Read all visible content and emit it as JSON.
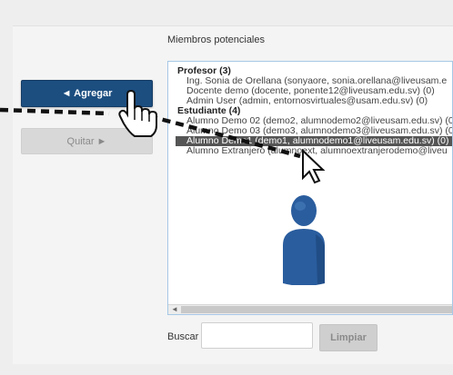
{
  "members": {
    "title": "Miembros potenciales",
    "groups": [
      {
        "label": "Profesor (3)",
        "options": [
          "Ing. Sonia de Orellana (sonyaore, sonia.orellana@liveusam.e",
          "Docente demo (docente, ponente12@liveusam.edu.sv) (0)",
          "Admin User (admin, entornosvirtuales@usam.edu.sv) (0)"
        ]
      },
      {
        "label": "Estudiante (4)",
        "options": [
          "Alumno Demo 02 (demo2, alumnodemo2@liveusam.edu.sv) (0)",
          "Alumno Demo 03 (demo3, alumnodemo3@liveusam.edu.sv) (0)",
          "Alumno Demo1 (demo1, alumnodemo1@liveusam.edu.sv) (0)",
          "Alumno Extranjero (alumnoext, alumnoextranjerodemo@liveu"
        ]
      }
    ],
    "selected_option": "Alumno Demo1 (demo1, alumnodemo1@liveusam.edu.sv) (0)"
  },
  "buttons": {
    "add": "◄ Agregar",
    "remove": "Quitar ►",
    "clear": "Limpiar"
  },
  "search": {
    "label": "Buscar",
    "value": ""
  },
  "colors": {
    "primary_button": "#1c4e80",
    "selection": "#555555",
    "figure": "#2a5d9e"
  },
  "icons": [
    "hand-pointer-icon",
    "arrow-cursor-icon",
    "user-figure-icon"
  ]
}
